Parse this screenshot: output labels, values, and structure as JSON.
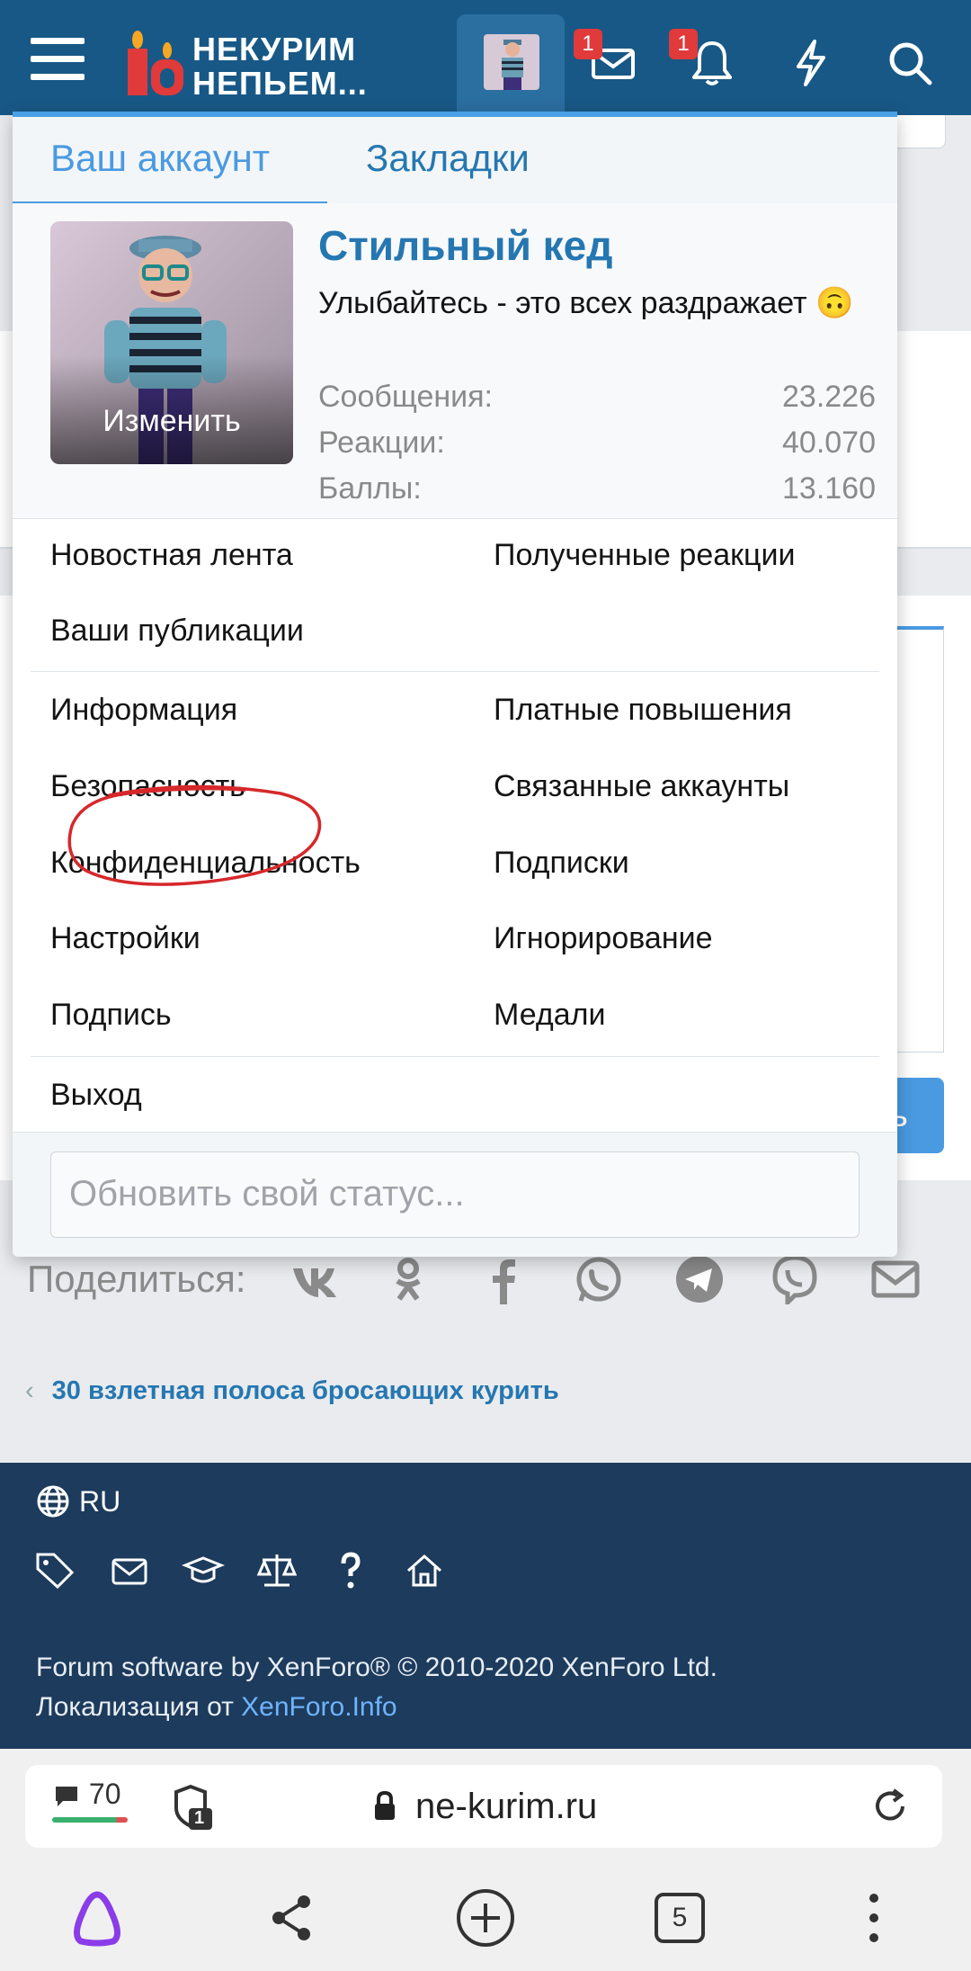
{
  "header": {
    "logo_text_line1": "НЕКУРИМ",
    "logo_text_line2": "НЕПЬЕМ...",
    "messages_badge": "1",
    "alerts_badge": "1"
  },
  "popup": {
    "tabs": [
      "Ваш аккаунт",
      "Закладки"
    ],
    "profile": {
      "avatar_edit": "Изменить",
      "username": "Стильный кед",
      "user_title": "Улыбайтесь - это всех раздражает 🙃",
      "stats": [
        {
          "label": "Сообщения:",
          "value": "23.226"
        },
        {
          "label": "Реакции:",
          "value": "40.070"
        },
        {
          "label": "Баллы:",
          "value": "13.160"
        }
      ]
    },
    "menu_group1": {
      "news_feed": "Новостная лента",
      "received_reactions": "Полученные реакции",
      "your_content": "Ваши публикации"
    },
    "menu_group2": {
      "info": "Информация",
      "paid_upgrades": "Платные повышения",
      "security": "Безопасность",
      "connected_accounts": "Связанные аккаунты",
      "privacy": "Конфиденциальность",
      "following": "Подписки",
      "preferences": "Настройки",
      "ignoring": "Игнорирование",
      "signature": "Подпись",
      "medals": "Медали"
    },
    "logout": "Выход",
    "status_placeholder": "Обновить свой статус..."
  },
  "page": {
    "share_label": "Поделиться:",
    "back_link": "30 взлетная полоса бросающих курить",
    "blue_button_fragment": "ь"
  },
  "footer": {
    "language": "RU",
    "copyright_line1": "Forum software by XenForo® © 2010-2020 XenForo Ltd.",
    "copyright_line2_prefix": "Локализация от ",
    "copyright_line2_link": "XenForo.Info"
  },
  "browser": {
    "comments_count": "70",
    "tabs_badge": "1",
    "url": "ne-kurim.ru",
    "open_tabs": "5"
  },
  "colors": {
    "header_bg": "#185886",
    "link_blue": "#2577b1",
    "accent_blue": "#4a9ae1",
    "footer_bg": "#1d3b5c",
    "badge_red": "#e03a3a",
    "annotation_red": "#d6282b"
  }
}
